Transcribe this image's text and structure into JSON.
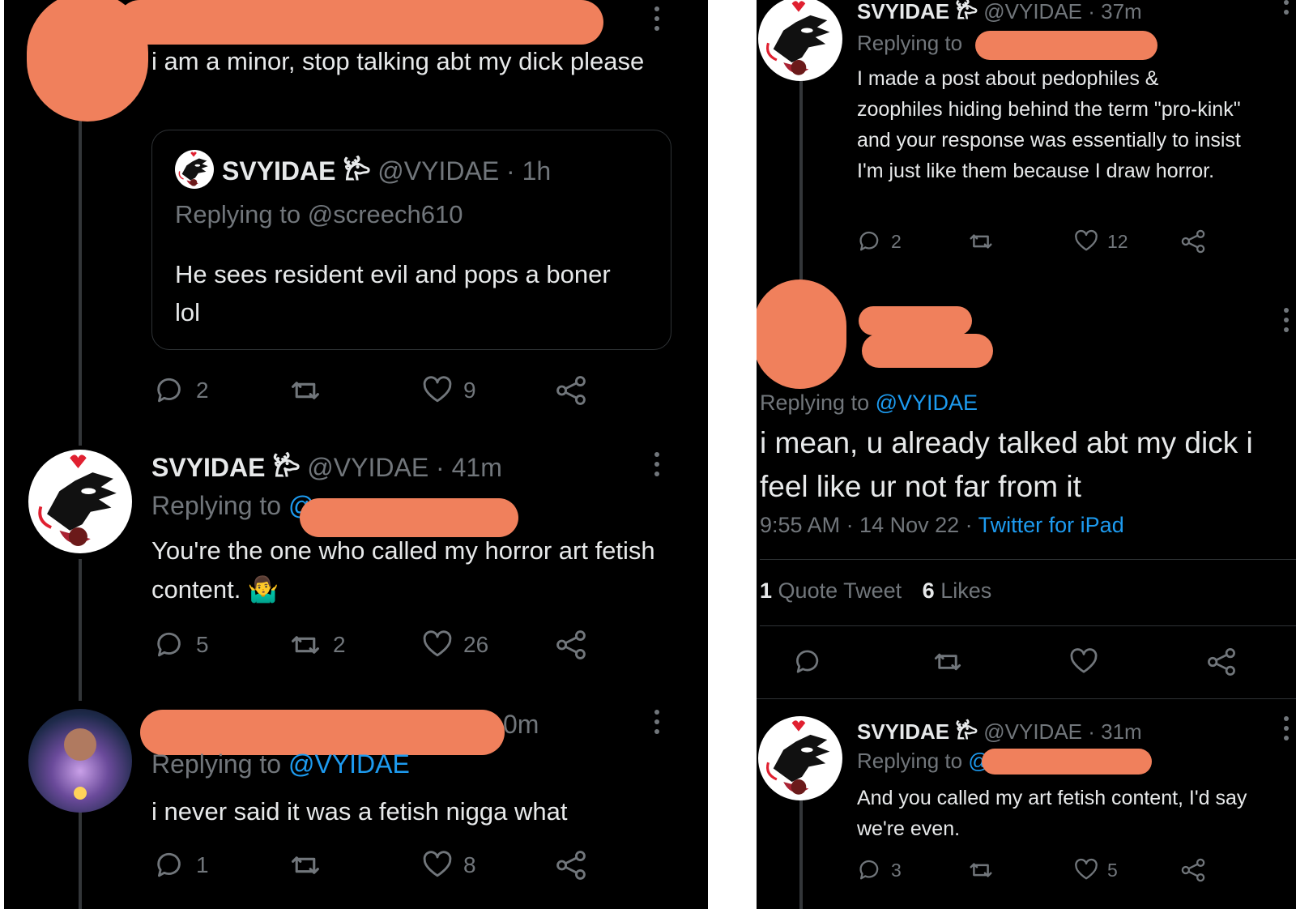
{
  "left": {
    "tweet1": {
      "text": "i am a minor, stop talking abt my dick please",
      "quote": {
        "name": "SVYIDAE 𐂂",
        "handle": "@VYIDAE",
        "time": "· 1h",
        "replying_label": "Replying to",
        "replying_handle": "@screech610",
        "text": "He sees resident evil and pops a boner lol"
      },
      "replies": "2",
      "retweets": "",
      "likes": "9"
    },
    "tweet2": {
      "name": "SVYIDAE 𐂂",
      "handle": "@VYIDAE",
      "time": "· 41m",
      "replying_label": "Replying to",
      "replying_handle": "@",
      "text": "You're the one who called my horror art fetish content. 🤷‍♂️",
      "replies": "5",
      "retweets": "2",
      "likes": "26"
    },
    "tweet3": {
      "time": "0m",
      "replying_label": "Replying to",
      "replying_handle": "@VYIDAE",
      "text": "i never said it was a fetish nigga what",
      "replies": "1",
      "retweets": "",
      "likes": "8"
    }
  },
  "right": {
    "tweet1": {
      "name": "SVYIDAE 𐂂",
      "handle": "@VYIDAE",
      "time": "· 37m",
      "replying_label": "Replying to",
      "text": "I made a post about pedophiles & zoophiles hiding behind the term \"pro-kink\" and your response was essentially to insist I'm just like them because I draw horror.",
      "replies": "2",
      "retweets": "",
      "likes": "12"
    },
    "main": {
      "replying_label": "Replying to",
      "replying_handle": "@VYIDAE",
      "text": "i mean, u already talked abt my dick i feel like ur not far from it",
      "timestamp": "9:55 AM · 14 Nov 22 ·",
      "client": "Twitter for iPad",
      "quote_count": "1",
      "quote_label": "Quote Tweet",
      "likes_count": "6",
      "likes_label": "Likes"
    },
    "tweet2": {
      "name": "SVYIDAE 𐂂",
      "handle": "@VYIDAE",
      "time": "· 31m",
      "replying_label": "Replying to",
      "replying_handle": "@",
      "text": "And you called my art fetish content, I'd say we're even.",
      "replies": "3",
      "retweets": "",
      "likes": "5"
    }
  },
  "colors": {
    "background": "#000000",
    "text": "#e7e9ea",
    "secondary": "#71767b",
    "link": "#1d9bf0",
    "redaction": "#f0805c",
    "border": "#2f3336"
  },
  "icons": [
    "reply-icon",
    "retweet-icon",
    "like-icon",
    "share-icon",
    "more-icon",
    "verified-symbol"
  ]
}
